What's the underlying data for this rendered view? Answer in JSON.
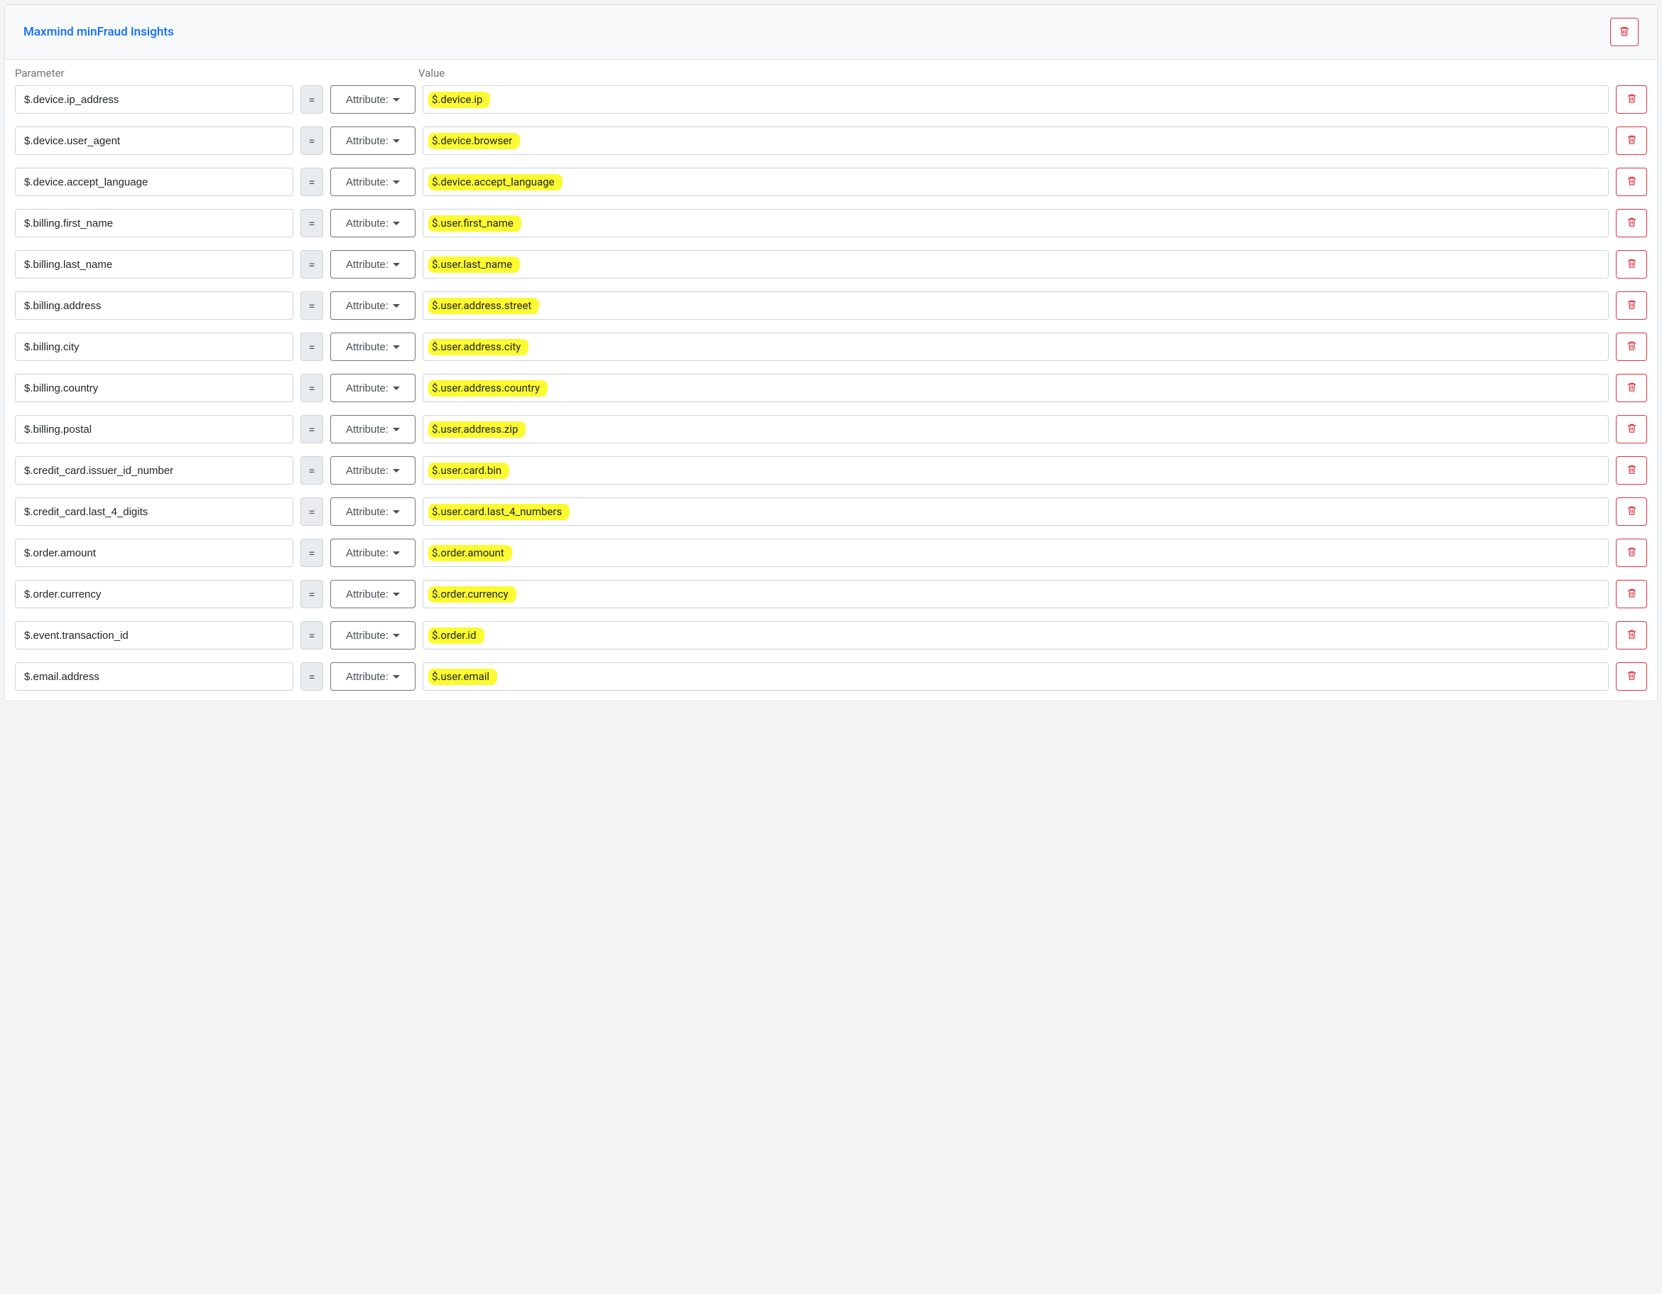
{
  "panel": {
    "title": "Maxmind minFraud Insights"
  },
  "columns": {
    "parameter": "Parameter",
    "value": "Value"
  },
  "labels": {
    "equals": "=",
    "attribute_dropdown": "Attribute:"
  },
  "rows": [
    {
      "parameter": "$.device.ip_address",
      "value": "$.device.ip"
    },
    {
      "parameter": "$.device.user_agent",
      "value": "$.device.browser"
    },
    {
      "parameter": "$.device.accept_language",
      "value": "$.device.accept_language"
    },
    {
      "parameter": "$.billing.first_name",
      "value": "$.user.first_name"
    },
    {
      "parameter": "$.billing.last_name",
      "value": "$.user.last_name"
    },
    {
      "parameter": "$.billing.address",
      "value": "$.user.address.street"
    },
    {
      "parameter": "$.billing.city",
      "value": "$.user.address.city"
    },
    {
      "parameter": "$.billing.country",
      "value": "$.user.address.country"
    },
    {
      "parameter": "$.billing.postal",
      "value": "$.user.address.zip"
    },
    {
      "parameter": "$.credit_card.issuer_id_number",
      "value": "$.user.card.bin"
    },
    {
      "parameter": "$.credit_card.last_4_digits",
      "value": "$.user.card.last_4_numbers"
    },
    {
      "parameter": "$.order.amount",
      "value": "$.order.amount"
    },
    {
      "parameter": "$.order.currency",
      "value": "$.order.currency"
    },
    {
      "parameter": "$.event.transaction_id",
      "value": "$.order.id"
    },
    {
      "parameter": "$.email.address",
      "value": "$.user.email"
    }
  ],
  "colors": {
    "danger": "#dc3545",
    "link": "#0d6efd",
    "highlight": "#fcfa30"
  }
}
